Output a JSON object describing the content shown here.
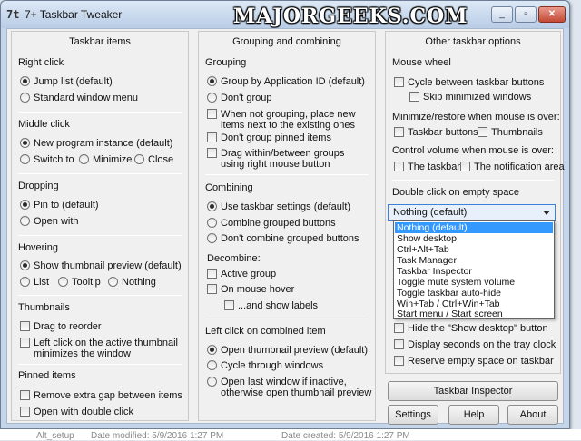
{
  "window": {
    "title": "7+ Taskbar Tweaker",
    "icon_glyph": "7t",
    "watermark": "MAJORGEEKS.COM",
    "min_glyph": "_",
    "max_glyph": "▫",
    "close_glyph": "✕"
  },
  "taskbar_items": {
    "header": "Taskbar items",
    "right_click": {
      "title": "Right click",
      "options": [
        "Jump list (default)",
        "Standard window menu"
      ]
    },
    "middle_click": {
      "title": "Middle click",
      "options": [
        "New program instance (default)",
        "Switch to",
        "Minimize",
        "Close"
      ]
    },
    "dropping": {
      "title": "Dropping",
      "options": [
        "Pin to (default)",
        "Open with"
      ]
    },
    "hovering": {
      "title": "Hovering",
      "options": [
        "Show thumbnail preview (default)",
        "List",
        "Tooltip",
        "Nothing"
      ]
    },
    "thumbnails": {
      "title": "Thumbnails",
      "drag_to_reorder": "Drag to reorder",
      "left_click_1": "Left click on the active thumbnail",
      "left_click_2": "minimizes the window"
    },
    "pinned_items": {
      "title": "Pinned items",
      "remove_gap": "Remove extra gap between items",
      "open_double": "Open with double click"
    }
  },
  "grouping": {
    "header": "Grouping and combining",
    "grouping_title": "Grouping",
    "group_by_app": "Group by Application ID (default)",
    "dont_group": "Don't group",
    "when_not_grouping_1": "When not grouping, place new",
    "when_not_grouping_2": "items next to the existing ones",
    "dont_group_pinned": "Don't group pinned items",
    "drag_within_1": "Drag within/between groups",
    "drag_within_2": "using right mouse button",
    "combining_title": "Combining",
    "use_taskbar_settings": "Use taskbar settings (default)",
    "combine_grouped": "Combine grouped buttons",
    "dont_combine": "Don't combine grouped buttons",
    "decombine_title": "Decombine:",
    "active_group": "Active group",
    "on_mouse_hover": "On mouse hover",
    "and_show_labels": "...and show labels",
    "left_click_title": "Left click on combined item",
    "open_thumbnail": "Open thumbnail preview (default)",
    "cycle_through": "Cycle through windows",
    "open_last_1": "Open last window if inactive,",
    "open_last_2": "otherwise open thumbnail preview"
  },
  "other": {
    "header": "Other taskbar options",
    "mouse_wheel_title": "Mouse wheel",
    "cycle_buttons": "Cycle between taskbar buttons",
    "skip_minimized": "Skip minimized windows",
    "minimize_restore_title": "Minimize/restore when mouse is over:",
    "taskbar_buttons": "Taskbar buttons",
    "thumbnails": "Thumbnails",
    "control_volume_title": "Control volume when mouse is over:",
    "the_taskbar": "The taskbar",
    "notification_area": "The notification area",
    "double_click_title": "Double click on empty space",
    "dropdown_value": "Nothing (default)",
    "dropdown_options": [
      "Nothing (default)",
      "Show desktop",
      "Ctrl+Alt+Tab",
      "Task Manager",
      "Taskbar Inspector",
      "Toggle mute system volume",
      "Toggle taskbar auto-hide",
      "Win+Tab / Ctrl+Win+Tab",
      "Start menu / Start screen"
    ],
    "hide_show_desktop": "Hide the \"Show desktop\" button",
    "display_seconds": "Display seconds on the tray clock",
    "reserve_space": "Reserve empty space on taskbar"
  },
  "buttons": {
    "taskbar_inspector": "Taskbar Inspector",
    "settings": "Settings",
    "help": "Help",
    "about": "About"
  },
  "background_text": {
    "left": "Alt_setup",
    "mid": "Date modified: 5/9/2016 1:27 PM",
    "right": "Date created: 5/9/2016 1:27 PM"
  }
}
